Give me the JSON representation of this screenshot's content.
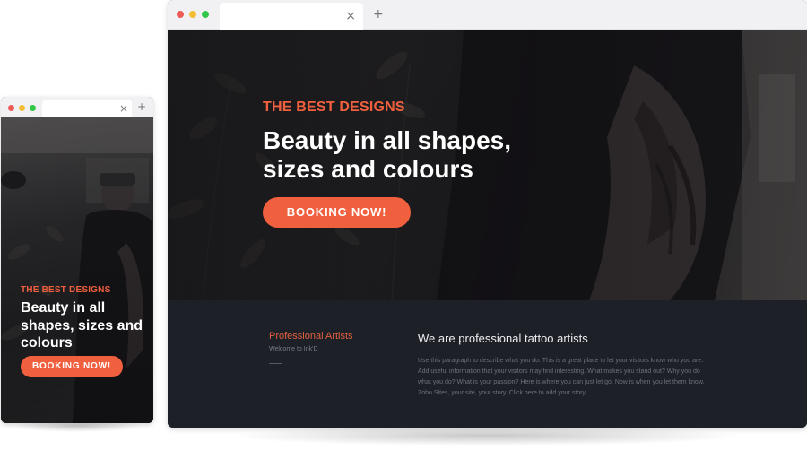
{
  "desktop": {
    "hero": {
      "eyebrow": "THE BEST DESIGNS",
      "headline_line1": "Beauty in all shapes,",
      "headline_line2": "sizes and colours",
      "cta_label": "BOOKING NOW!"
    },
    "info": {
      "sidebar_title": "Professional Artists",
      "sidebar_meta": "Welcome to Ink'D",
      "title": "We are professional tattoo artists",
      "body": "Use this paragraph to describe what you do. This is a great place to let your visitors know who you are. Add useful information that your visitors may find interesting. What makes you stand out? Why you do what you do? What is your passion? Here is where you can just let go. Now is when you let them know. Zoho Sites, your site, your story. Click here to add your story."
    }
  },
  "mobile": {
    "hero": {
      "eyebrow": "THE BEST DESIGNS",
      "headline_line1": "Beauty in all",
      "headline_line2": "shapes, sizes and",
      "headline_line3": "colours",
      "cta_label": "BOOKING NOW!"
    }
  },
  "browser": {
    "close_glyph": "×",
    "new_tab_glyph": "+"
  },
  "colors": {
    "accent": "#f0603f",
    "dark_bg": "#1e2028",
    "chrome_bg": "#f1f1f3",
    "dot_red": "#ee5a55",
    "dot_yellow": "#f4bd35",
    "dot_green": "#33c748"
  },
  "icons": [
    "close-icon",
    "plus-icon",
    "window-control-dots"
  ]
}
